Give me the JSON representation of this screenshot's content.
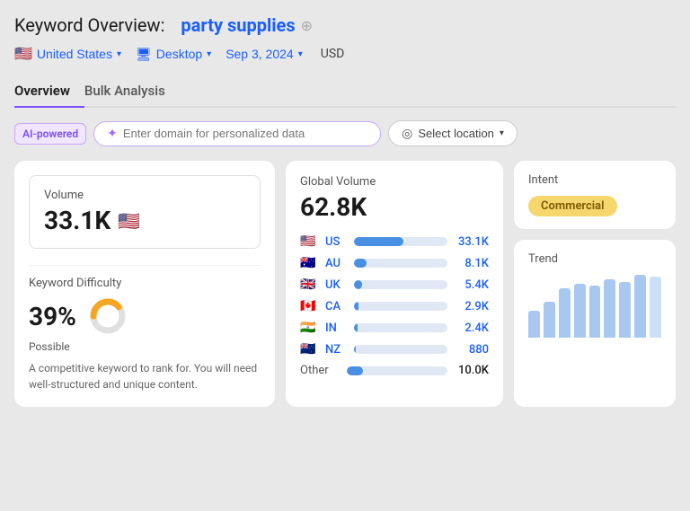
{
  "header": {
    "title_prefix": "Keyword Overview:",
    "keyword": "party supplies",
    "plus_icon": "⊕"
  },
  "filters": {
    "country": "United States",
    "country_flag": "🇺🇸",
    "device": "Desktop",
    "device_icon": "🖥",
    "date": "Sep 3, 2024",
    "currency": "USD"
  },
  "tabs": [
    {
      "id": "overview",
      "label": "Overview",
      "active": true
    },
    {
      "id": "bulk",
      "label": "Bulk Analysis",
      "active": false
    }
  ],
  "ai_row": {
    "badge": "AI-powered",
    "input_placeholder": "Enter domain for personalized data",
    "location_label": "Select location"
  },
  "volume_card": {
    "volume_label": "Volume",
    "volume_value": "33.1K",
    "flag": "🇺🇸",
    "kd_label": "Keyword Difficulty",
    "kd_value": "39%",
    "kd_possible": "Possible",
    "kd_desc": "A competitive keyword to rank for. You will need well-structured and unique content.",
    "kd_percent": 39
  },
  "global_card": {
    "label": "Global Volume",
    "value": "62.8K",
    "countries": [
      {
        "flag": "🇺🇸",
        "code": "US",
        "bar_pct": 53,
        "value": "33.1K"
      },
      {
        "flag": "🇦🇺",
        "code": "AU",
        "bar_pct": 13,
        "value": "8.1K"
      },
      {
        "flag": "🇬🇧",
        "code": "UK",
        "bar_pct": 9,
        "value": "5.4K"
      },
      {
        "flag": "🇨🇦",
        "code": "CA",
        "bar_pct": 5,
        "value": "2.9K"
      },
      {
        "flag": "🇮🇳",
        "code": "IN",
        "bar_pct": 4,
        "value": "2.4K"
      },
      {
        "flag": "🇳🇿",
        "code": "NZ",
        "bar_pct": 2,
        "value": "880"
      }
    ],
    "other_label": "Other",
    "other_value": "10.0K",
    "other_bar_pct": 16
  },
  "intent_card": {
    "label": "Intent",
    "badge": "Commercial"
  },
  "trend_card": {
    "label": "Trend",
    "bars": [
      30,
      40,
      55,
      60,
      58,
      65,
      62,
      70,
      68
    ]
  }
}
